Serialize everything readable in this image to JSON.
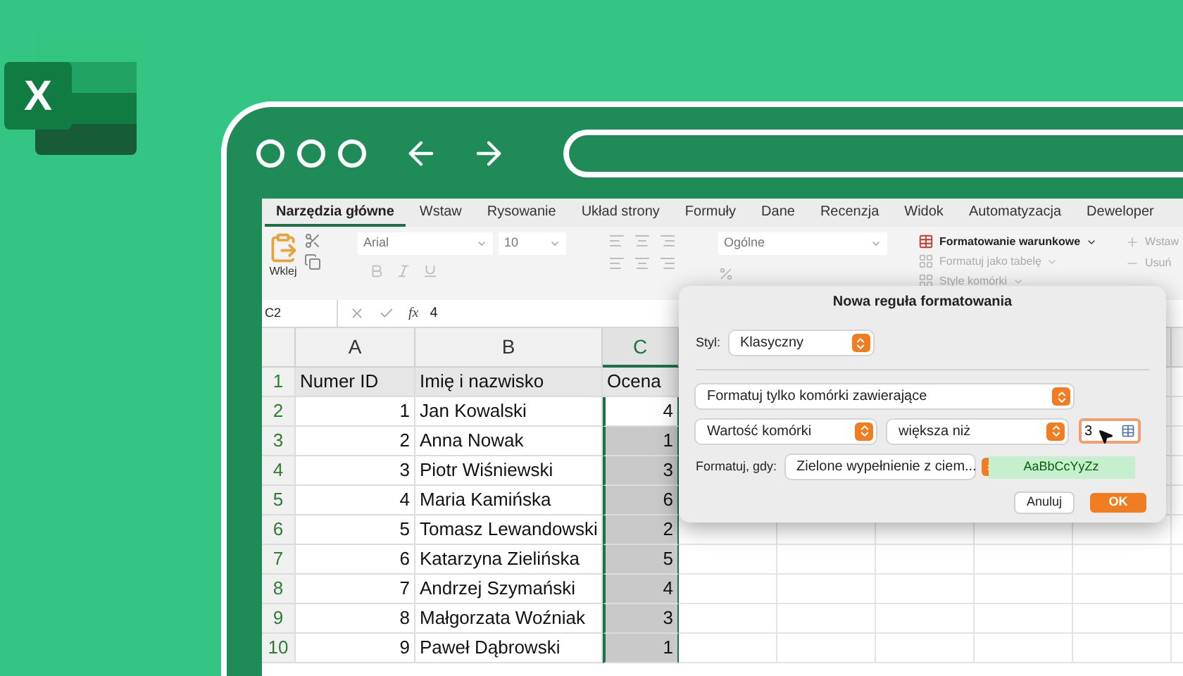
{
  "logo": {
    "letter": "X"
  },
  "ribbon": {
    "tabs": [
      {
        "label": "Narzędzia główne",
        "selected": true
      },
      {
        "label": "Wstaw",
        "selected": false
      },
      {
        "label": "Rysowanie",
        "selected": false
      },
      {
        "label": "Układ strony",
        "selected": false
      },
      {
        "label": "Formuły",
        "selected": false
      },
      {
        "label": "Dane",
        "selected": false
      },
      {
        "label": "Recenzja",
        "selected": false
      },
      {
        "label": "Widok",
        "selected": false
      },
      {
        "label": "Automatyzacja",
        "selected": false
      },
      {
        "label": "Deweloper",
        "selected": false
      }
    ],
    "paste_label": "Wklej",
    "font": "Arial",
    "font_size": "10",
    "number_format": "Ogólne",
    "styles": [
      {
        "label": "Formatowanie warunkowe",
        "disabled": false
      },
      {
        "label": "Formatuj jako tabelę",
        "disabled": true
      },
      {
        "label": "Style komórki",
        "disabled": true
      }
    ],
    "cells": [
      {
        "label": "Wstaw",
        "disabled": true
      },
      {
        "label": "Usuń",
        "disabled": true
      }
    ]
  },
  "formula_bar": {
    "cell": "C2",
    "fx": "fx",
    "value": "4"
  },
  "sheet": {
    "columns": [
      {
        "label": "A",
        "selected": false
      },
      {
        "label": "B",
        "selected": false
      },
      {
        "label": "C",
        "selected": true
      }
    ],
    "header_row": {
      "number": "1",
      "cells": [
        "Numer ID",
        "Imię i nazwisko",
        "Ocena"
      ]
    },
    "rows": [
      {
        "number": "2",
        "id": "1",
        "name": "Jan Kowalski",
        "score": "4",
        "active": true,
        "selected": true
      },
      {
        "number": "3",
        "id": "2",
        "name": "Anna Nowak",
        "score": "1",
        "active": false,
        "selected": true
      },
      {
        "number": "4",
        "id": "3",
        "name": "Piotr Wiśniewski",
        "score": "3",
        "active": false,
        "selected": true
      },
      {
        "number": "5",
        "id": "4",
        "name": "Maria Kamińska",
        "score": "6",
        "active": false,
        "selected": true
      },
      {
        "number": "6",
        "id": "5",
        "name": "Tomasz Lewandowski",
        "score": "2",
        "active": false,
        "selected": true
      },
      {
        "number": "7",
        "id": "6",
        "name": "Katarzyna Zielińska",
        "score": "5",
        "active": false,
        "selected": true
      },
      {
        "number": "8",
        "id": "7",
        "name": "Andrzej Szymański",
        "score": "4",
        "active": false,
        "selected": true
      },
      {
        "number": "9",
        "id": "8",
        "name": "Małgorzata Woźniak",
        "score": "3",
        "active": false,
        "selected": true
      },
      {
        "number": "10",
        "id": "9",
        "name": "Paweł Dąbrowski",
        "score": "1",
        "active": false,
        "selected": true
      }
    ]
  },
  "dialog": {
    "title": "Nowa reguła formatowania",
    "style_label": "Styl:",
    "style_value": "Klasyczny",
    "rule_type": "Formatuj tylko komórki zawierające",
    "condition_field": "Wartość komórki",
    "operator": "większa niż",
    "value": "3",
    "format_label": "Formatuj, gdy:",
    "format_value": "Zielone wypełnienie z ciem...",
    "preview": "AaBbCcYyZz",
    "buttons": [
      {
        "label": "Anuluj",
        "kind": "secondary"
      },
      {
        "label": "OK",
        "kind": "primary"
      }
    ]
  }
}
